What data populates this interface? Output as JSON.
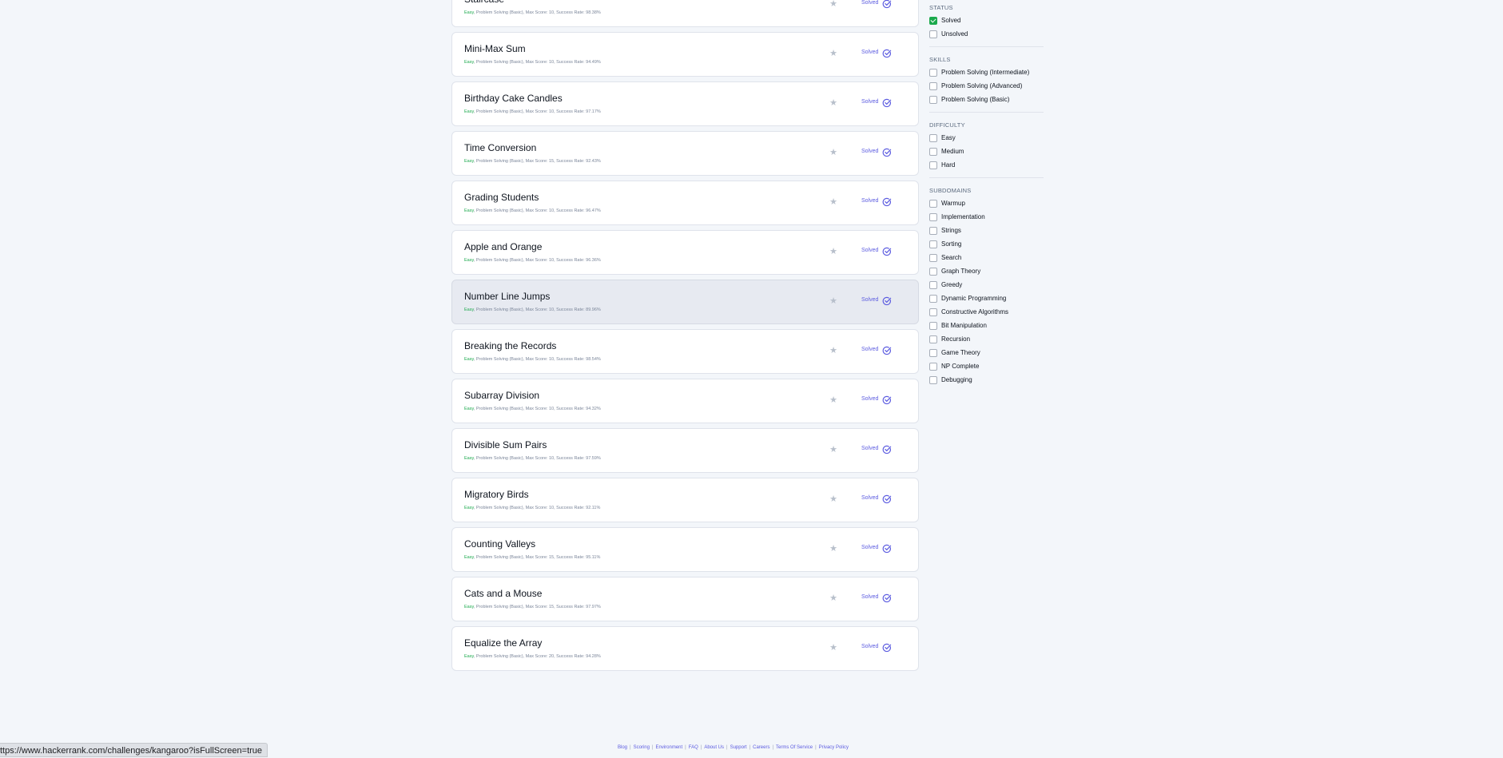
{
  "challenges": [
    {
      "title": "Staircase",
      "difficulty": "Easy",
      "meta": ", Problem Solving (Basic), Max Score: 10, Success Rate: 98.38%",
      "status": "Solved"
    },
    {
      "title": "Mini-Max Sum",
      "difficulty": "Easy",
      "meta": ", Problem Solving (Basic), Max Score: 10, Success Rate: 94.49%",
      "status": "Solved"
    },
    {
      "title": "Birthday Cake Candles",
      "difficulty": "Easy",
      "meta": ", Problem Solving (Basic), Max Score: 10, Success Rate: 97.17%",
      "status": "Solved"
    },
    {
      "title": "Time Conversion",
      "difficulty": "Easy",
      "meta": ", Problem Solving (Basic), Max Score: 15, Success Rate: 92.43%",
      "status": "Solved"
    },
    {
      "title": "Grading Students",
      "difficulty": "Easy",
      "meta": ", Problem Solving (Basic), Max Score: 10, Success Rate: 96.47%",
      "status": "Solved"
    },
    {
      "title": "Apple and Orange",
      "difficulty": "Easy",
      "meta": ", Problem Solving (Basic), Max Score: 10, Success Rate: 96.36%",
      "status": "Solved"
    },
    {
      "title": "Number Line Jumps",
      "difficulty": "Easy",
      "meta": ", Problem Solving (Basic), Max Score: 10, Success Rate: 89.96%",
      "status": "Solved"
    },
    {
      "title": "Breaking the Records",
      "difficulty": "Easy",
      "meta": ", Problem Solving (Basic), Max Score: 10, Success Rate: 98.54%",
      "status": "Solved"
    },
    {
      "title": "Subarray Division",
      "difficulty": "Easy",
      "meta": ", Problem Solving (Basic), Max Score: 10, Success Rate: 94.32%",
      "status": "Solved"
    },
    {
      "title": "Divisible Sum Pairs",
      "difficulty": "Easy",
      "meta": ", Problem Solving (Basic), Max Score: 10, Success Rate: 97.59%",
      "status": "Solved"
    },
    {
      "title": "Migratory Birds",
      "difficulty": "Easy",
      "meta": ", Problem Solving (Basic), Max Score: 10, Success Rate: 92.11%",
      "status": "Solved"
    },
    {
      "title": "Counting Valleys",
      "difficulty": "Easy",
      "meta": ", Problem Solving (Basic), Max Score: 15, Success Rate: 95.11%",
      "status": "Solved"
    },
    {
      "title": "Cats and a Mouse",
      "difficulty": "Easy",
      "meta": ", Problem Solving (Basic), Max Score: 15, Success Rate: 97.97%",
      "status": "Solved"
    },
    {
      "title": "Equalize the Array",
      "difficulty": "Easy",
      "meta": ", Problem Solving (Basic), Max Score: 20, Success Rate: 94.28%",
      "status": "Solved"
    }
  ],
  "hovered_index": 6,
  "filters": {
    "status": {
      "title": "STATUS",
      "options": [
        {
          "label": "Solved",
          "checked": true
        },
        {
          "label": "Unsolved",
          "checked": false
        }
      ]
    },
    "skills": {
      "title": "SKILLS",
      "options": [
        {
          "label": "Problem Solving (Intermediate)"
        },
        {
          "label": "Problem Solving (Advanced)"
        },
        {
          "label": "Problem Solving (Basic)"
        }
      ]
    },
    "difficulty": {
      "title": "DIFFICULTY",
      "options": [
        {
          "label": "Easy"
        },
        {
          "label": "Medium"
        },
        {
          "label": "Hard"
        }
      ]
    },
    "subdomains": {
      "title": "SUBDOMAINS",
      "options": [
        {
          "label": "Warmup"
        },
        {
          "label": "Implementation"
        },
        {
          "label": "Strings"
        },
        {
          "label": "Sorting"
        },
        {
          "label": "Search"
        },
        {
          "label": "Graph Theory"
        },
        {
          "label": "Greedy"
        },
        {
          "label": "Dynamic Programming"
        },
        {
          "label": "Constructive Algorithms"
        },
        {
          "label": "Bit Manipulation"
        },
        {
          "label": "Recursion"
        },
        {
          "label": "Game Theory"
        },
        {
          "label": "NP Complete"
        },
        {
          "label": "Debugging"
        }
      ]
    }
  },
  "footer_links": [
    "Blog",
    "Scoring",
    "Environment",
    "FAQ",
    "About Us",
    "Support",
    "Careers",
    "Terms Of Service",
    "Privacy Policy"
  ],
  "status_bar_url": "ttps://www.hackerrank.com/challenges/kangaroo?isFullScreen=true",
  "colors": {
    "accent": "#5c5ce0",
    "success": "#1ba94c",
    "background": "#f3f6fa"
  }
}
